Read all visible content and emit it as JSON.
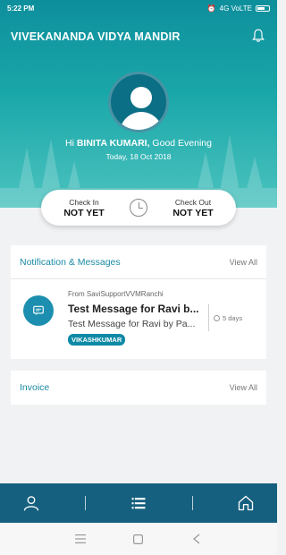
{
  "status_bar": {
    "time": "5:22 PM",
    "network": "4G VoLTE"
  },
  "header": {
    "app_title": "VIVEKANANDA VIDYA MANDIR",
    "greeting_prefix": "Hi ",
    "user_name": "BINITA KUMARI,",
    "greeting_suffix": " Good Evening",
    "date": "Today, 18 Oct 2018"
  },
  "attendance": {
    "check_in_label": "Check In",
    "check_in_value": "NOT YET",
    "check_out_label": "Check Out",
    "check_out_value": "NOT YET"
  },
  "notifications": {
    "title": "Notification & Messages",
    "view_all": "View All",
    "items": [
      {
        "from": "From SaviSupportVVMRanchi",
        "title": "Test Message for Ravi b...",
        "body": "Test Message for Ravi by Pa...",
        "tag": "VIKASHKUMAR",
        "time": "5 days"
      }
    ]
  },
  "invoice": {
    "title": "Invoice",
    "view_all": "View All"
  },
  "colors": {
    "header_top": "#0e8f9c",
    "header_bottom": "#4cc3bf",
    "accent": "#1a8aa3",
    "nav_bar": "#15607f",
    "tag_bg": "#0f8aa6"
  },
  "icons": {
    "bell": "bell-icon",
    "avatar": "user-avatar-icon",
    "clock": "clock-icon",
    "message": "message-icon",
    "profile_tab": "user-icon",
    "list_tab": "list-icon",
    "home_tab": "home-icon"
  }
}
